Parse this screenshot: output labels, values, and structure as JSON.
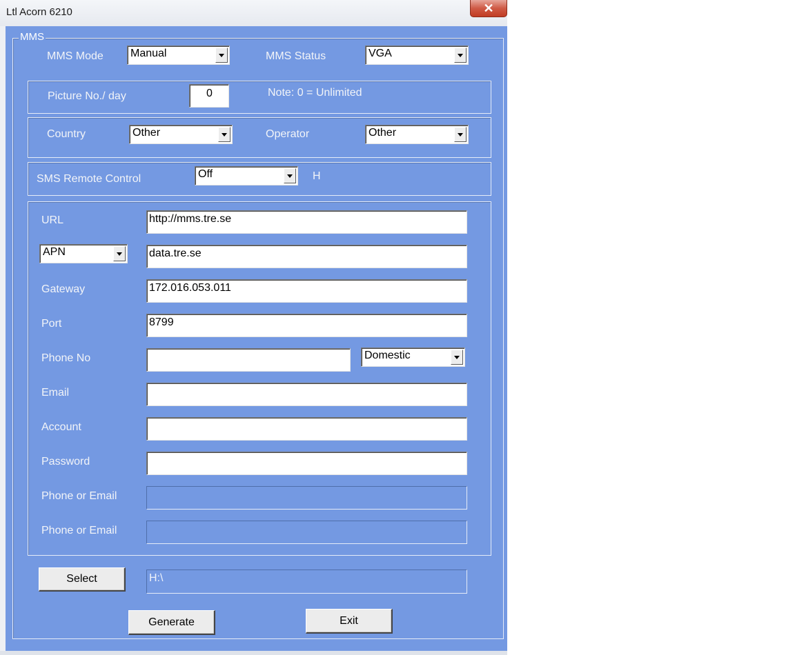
{
  "window": {
    "title": "Ltl Acorn 6210",
    "close_glyph": "✕"
  },
  "mms_group": {
    "legend": "MMS"
  },
  "mms_mode": {
    "label": "MMS Mode",
    "value": "Manual"
  },
  "mms_status": {
    "label": "MMS Status",
    "value": "VGA"
  },
  "picture": {
    "label": "Picture No./ day",
    "value": "0",
    "note": "Note: 0 = Unlimited"
  },
  "country": {
    "label": "Country",
    "value": "Other"
  },
  "operator": {
    "label": "Operator",
    "value": "Other"
  },
  "sms_remote": {
    "label": "SMS Remote Control",
    "value": "Off",
    "suffix": "H"
  },
  "connection": {
    "url": {
      "label": "URL",
      "value": "http://mms.tre.se"
    },
    "apn": {
      "selector": "APN",
      "value": "data.tre.se"
    },
    "gateway": {
      "label": "Gateway",
      "value": "172.016.053.011"
    },
    "port": {
      "label": "Port",
      "value": "8799"
    },
    "phone": {
      "label": "Phone No",
      "value": "",
      "region": "Domestic"
    },
    "email": {
      "label": "Email",
      "value": ""
    },
    "account": {
      "label": "Account",
      "value": ""
    },
    "password": {
      "label": "Password",
      "value": ""
    },
    "phone_or_email_1": {
      "label": "Phone or Email",
      "value": ""
    },
    "phone_or_email_2": {
      "label": "Phone or Email",
      "value": ""
    }
  },
  "select_row": {
    "button": "Select",
    "path": "H:\\"
  },
  "actions": {
    "generate": "Generate",
    "exit": "Exit"
  }
}
